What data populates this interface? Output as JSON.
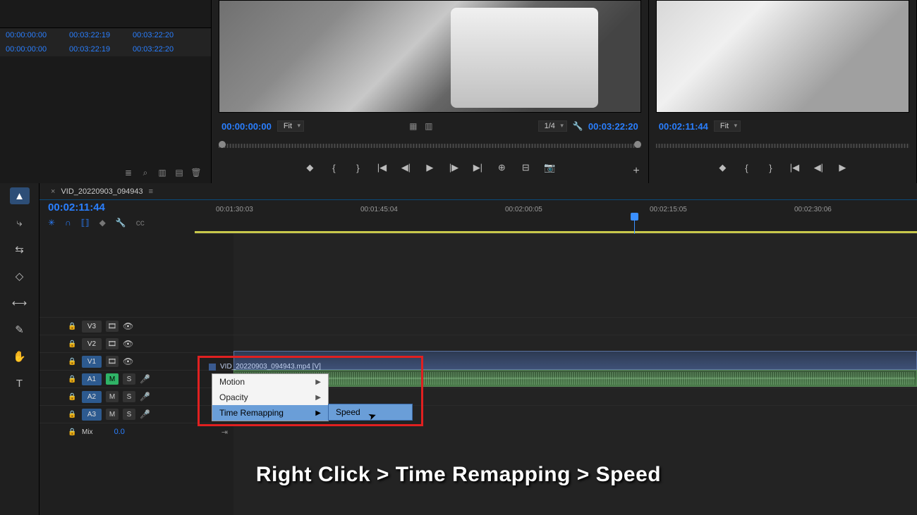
{
  "media_panel": {
    "row1": {
      "c1": "00:00:00:00",
      "c2": "00:03:22:19",
      "c3": "00:03:22:20"
    },
    "row2": {
      "c1": "00:00:00:00",
      "c2": "00:03:22:19",
      "c3": "00:03:22:20"
    }
  },
  "source_monitor": {
    "tc_in": "00:00:00:00",
    "fit": "Fit",
    "scale": "1/4",
    "tc_out": "00:03:22:20"
  },
  "program_monitor": {
    "tc_in": "00:02:11:44",
    "fit": "Fit"
  },
  "sequence": {
    "tab_name": "VID_20220903_094943",
    "playhead_tc": "00:02:11:44",
    "ruler": [
      "00:01:30:03",
      "00:01:45:04",
      "00:02:00:05",
      "00:02:15:05",
      "00:02:30:06"
    ],
    "tracks": {
      "v3": "V3",
      "v2": "V2",
      "v1": "V1",
      "a1": "A1",
      "a2": "A2",
      "a3": "A3",
      "mix": "Mix",
      "mix_val": "0.0",
      "m": "M",
      "s": "S"
    }
  },
  "clip": {
    "name": "VID_20220903_094943.mp4 [V]"
  },
  "context_menu": {
    "motion": "Motion",
    "opacity": "Opacity",
    "time_remapping": "Time Remapping",
    "speed": "Speed"
  },
  "caption": "Right Click > Time Remapping > Speed"
}
